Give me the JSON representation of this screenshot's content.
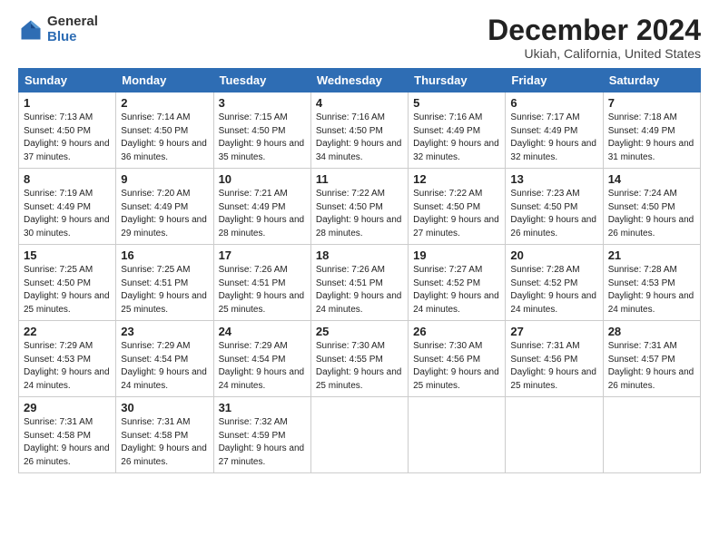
{
  "logo": {
    "general": "General",
    "blue": "Blue"
  },
  "title": "December 2024",
  "subtitle": "Ukiah, California, United States",
  "days_of_week": [
    "Sunday",
    "Monday",
    "Tuesday",
    "Wednesday",
    "Thursday",
    "Friday",
    "Saturday"
  ],
  "weeks": [
    [
      {
        "day": "1",
        "info": "Sunrise: 7:13 AM\nSunset: 4:50 PM\nDaylight: 9 hours\nand 37 minutes."
      },
      {
        "day": "2",
        "info": "Sunrise: 7:14 AM\nSunset: 4:50 PM\nDaylight: 9 hours\nand 36 minutes."
      },
      {
        "day": "3",
        "info": "Sunrise: 7:15 AM\nSunset: 4:50 PM\nDaylight: 9 hours\nand 35 minutes."
      },
      {
        "day": "4",
        "info": "Sunrise: 7:16 AM\nSunset: 4:50 PM\nDaylight: 9 hours\nand 34 minutes."
      },
      {
        "day": "5",
        "info": "Sunrise: 7:16 AM\nSunset: 4:49 PM\nDaylight: 9 hours\nand 32 minutes."
      },
      {
        "day": "6",
        "info": "Sunrise: 7:17 AM\nSunset: 4:49 PM\nDaylight: 9 hours\nand 32 minutes."
      },
      {
        "day": "7",
        "info": "Sunrise: 7:18 AM\nSunset: 4:49 PM\nDaylight: 9 hours\nand 31 minutes."
      }
    ],
    [
      {
        "day": "8",
        "info": "Sunrise: 7:19 AM\nSunset: 4:49 PM\nDaylight: 9 hours\nand 30 minutes."
      },
      {
        "day": "9",
        "info": "Sunrise: 7:20 AM\nSunset: 4:49 PM\nDaylight: 9 hours\nand 29 minutes."
      },
      {
        "day": "10",
        "info": "Sunrise: 7:21 AM\nSunset: 4:49 PM\nDaylight: 9 hours\nand 28 minutes."
      },
      {
        "day": "11",
        "info": "Sunrise: 7:22 AM\nSunset: 4:50 PM\nDaylight: 9 hours\nand 28 minutes."
      },
      {
        "day": "12",
        "info": "Sunrise: 7:22 AM\nSunset: 4:50 PM\nDaylight: 9 hours\nand 27 minutes."
      },
      {
        "day": "13",
        "info": "Sunrise: 7:23 AM\nSunset: 4:50 PM\nDaylight: 9 hours\nand 26 minutes."
      },
      {
        "day": "14",
        "info": "Sunrise: 7:24 AM\nSunset: 4:50 PM\nDaylight: 9 hours\nand 26 minutes."
      }
    ],
    [
      {
        "day": "15",
        "info": "Sunrise: 7:25 AM\nSunset: 4:50 PM\nDaylight: 9 hours\nand 25 minutes."
      },
      {
        "day": "16",
        "info": "Sunrise: 7:25 AM\nSunset: 4:51 PM\nDaylight: 9 hours\nand 25 minutes."
      },
      {
        "day": "17",
        "info": "Sunrise: 7:26 AM\nSunset: 4:51 PM\nDaylight: 9 hours\nand 25 minutes."
      },
      {
        "day": "18",
        "info": "Sunrise: 7:26 AM\nSunset: 4:51 PM\nDaylight: 9 hours\nand 24 minutes."
      },
      {
        "day": "19",
        "info": "Sunrise: 7:27 AM\nSunset: 4:52 PM\nDaylight: 9 hours\nand 24 minutes."
      },
      {
        "day": "20",
        "info": "Sunrise: 7:28 AM\nSunset: 4:52 PM\nDaylight: 9 hours\nand 24 minutes."
      },
      {
        "day": "21",
        "info": "Sunrise: 7:28 AM\nSunset: 4:53 PM\nDaylight: 9 hours\nand 24 minutes."
      }
    ],
    [
      {
        "day": "22",
        "info": "Sunrise: 7:29 AM\nSunset: 4:53 PM\nDaylight: 9 hours\nand 24 minutes."
      },
      {
        "day": "23",
        "info": "Sunrise: 7:29 AM\nSunset: 4:54 PM\nDaylight: 9 hours\nand 24 minutes."
      },
      {
        "day": "24",
        "info": "Sunrise: 7:29 AM\nSunset: 4:54 PM\nDaylight: 9 hours\nand 24 minutes."
      },
      {
        "day": "25",
        "info": "Sunrise: 7:30 AM\nSunset: 4:55 PM\nDaylight: 9 hours\nand 25 minutes."
      },
      {
        "day": "26",
        "info": "Sunrise: 7:30 AM\nSunset: 4:56 PM\nDaylight: 9 hours\nand 25 minutes."
      },
      {
        "day": "27",
        "info": "Sunrise: 7:31 AM\nSunset: 4:56 PM\nDaylight: 9 hours\nand 25 minutes."
      },
      {
        "day": "28",
        "info": "Sunrise: 7:31 AM\nSunset: 4:57 PM\nDaylight: 9 hours\nand 26 minutes."
      }
    ],
    [
      {
        "day": "29",
        "info": "Sunrise: 7:31 AM\nSunset: 4:58 PM\nDaylight: 9 hours\nand 26 minutes."
      },
      {
        "day": "30",
        "info": "Sunrise: 7:31 AM\nSunset: 4:58 PM\nDaylight: 9 hours\nand 26 minutes."
      },
      {
        "day": "31",
        "info": "Sunrise: 7:32 AM\nSunset: 4:59 PM\nDaylight: 9 hours\nand 27 minutes."
      },
      {
        "day": "",
        "info": ""
      },
      {
        "day": "",
        "info": ""
      },
      {
        "day": "",
        "info": ""
      },
      {
        "day": "",
        "info": ""
      }
    ]
  ]
}
